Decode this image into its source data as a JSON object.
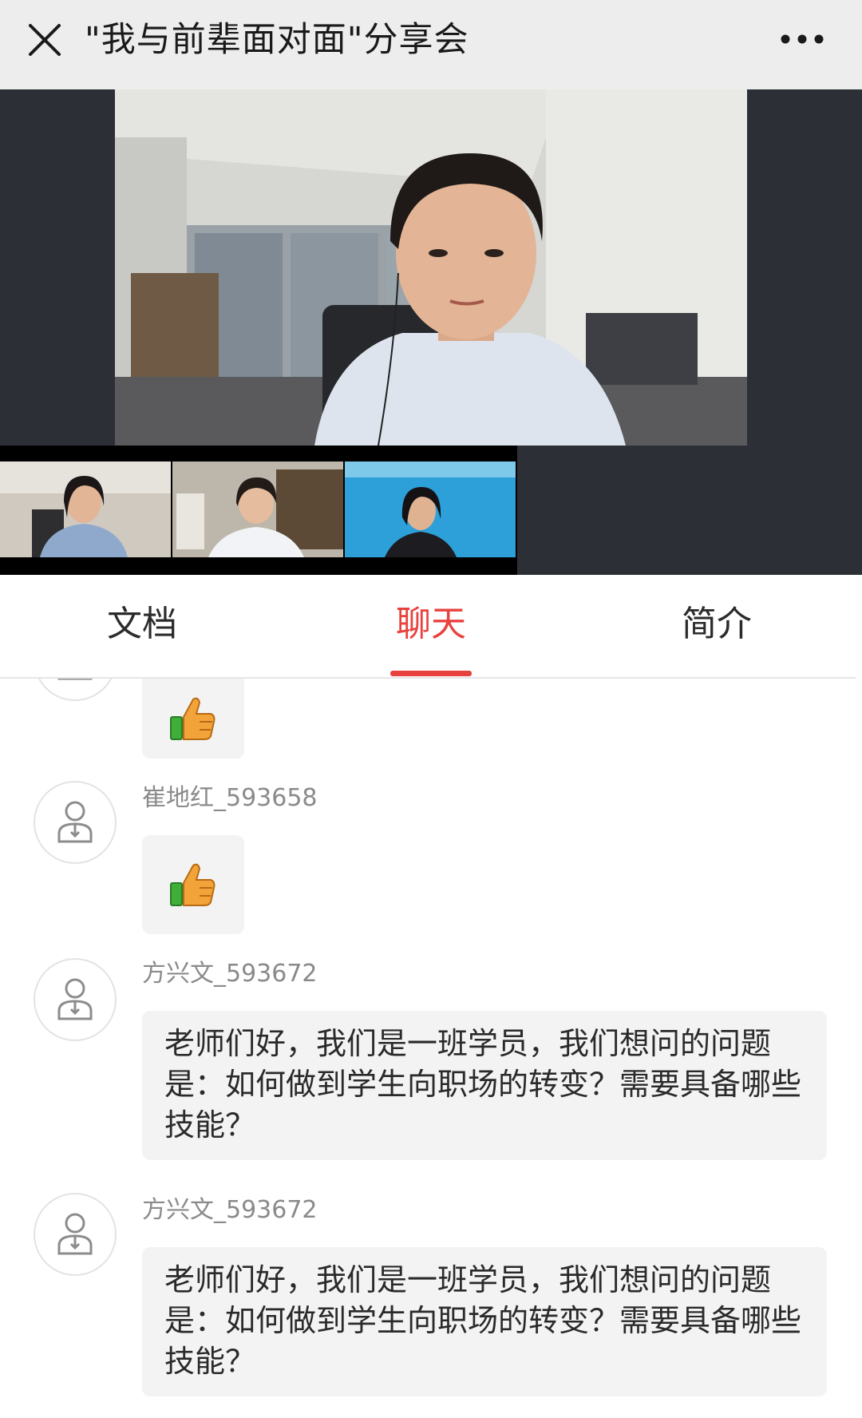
{
  "header": {
    "title": "\"我与前辈面对面\"分享会",
    "close_icon": "close-icon",
    "more_icon": "more-dots-icon"
  },
  "video": {
    "main_speaker": "main-video-feed",
    "thumbnails": [
      "participant-1",
      "participant-2",
      "participant-3"
    ]
  },
  "tabs": [
    {
      "label": "文档",
      "active": false
    },
    {
      "label": "聊天",
      "active": true
    },
    {
      "label": "简介",
      "active": false
    }
  ],
  "colors": {
    "accent": "#e8423f",
    "header_bg": "#ededed",
    "bubble_bg": "#f3f3f3",
    "video_bg": "#2c3036"
  },
  "chat": {
    "messages": [
      {
        "type": "emoji",
        "emoji": "thumbs-up-icon"
      },
      {
        "user": "崔地红_593658",
        "type": "emoji",
        "emoji": "thumbs-up-icon"
      },
      {
        "user": "方兴文_593672",
        "type": "text",
        "text": "老师们好，我们是一班学员，我们想问的问题是：如何做到学生向职场的转变？需要具备哪些技能？"
      },
      {
        "user": "方兴文_593672",
        "type": "text",
        "text": "老师们好，我们是一班学员，我们想问的问题是：如何做到学生向职场的转变？需要具备哪些技能？"
      }
    ]
  }
}
